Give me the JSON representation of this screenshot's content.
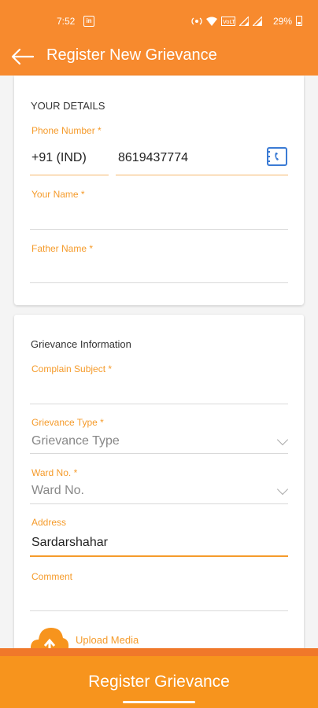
{
  "status_bar": {
    "time": "7:52",
    "battery": "29%",
    "icons": [
      "linkedin-icon",
      "hotspot-icon",
      "wifi-icon",
      "volte-icon",
      "signal-icon",
      "signal-icon",
      "battery-icon"
    ]
  },
  "app_bar": {
    "title": "Register New Grievance"
  },
  "your_details": {
    "section_title": "YOUR DETAILS",
    "phone_label": "Phone Number *",
    "country_code": "+91 (IND)",
    "phone_value": "8619437774",
    "name_label": "Your Name *",
    "name_value": "",
    "father_label": "Father Name *",
    "father_value": ""
  },
  "grievance_info": {
    "section_title": "Grievance Information",
    "subject_label": "Complain Subject *",
    "subject_value": "",
    "type_label": "Grievance Type *",
    "type_placeholder": "Grievance Type",
    "ward_label": "Ward No. *",
    "ward_placeholder": "Ward No.",
    "address_label": "Address",
    "address_value": "Sardarshahar",
    "comment_label": "Comment",
    "comment_value": "",
    "upload_label": "Upload Media"
  },
  "submit_button": {
    "label": "Register Grievance"
  },
  "colors": {
    "accent": "#f78a2e",
    "label": "#f59b2b",
    "button": "#f7941d"
  }
}
